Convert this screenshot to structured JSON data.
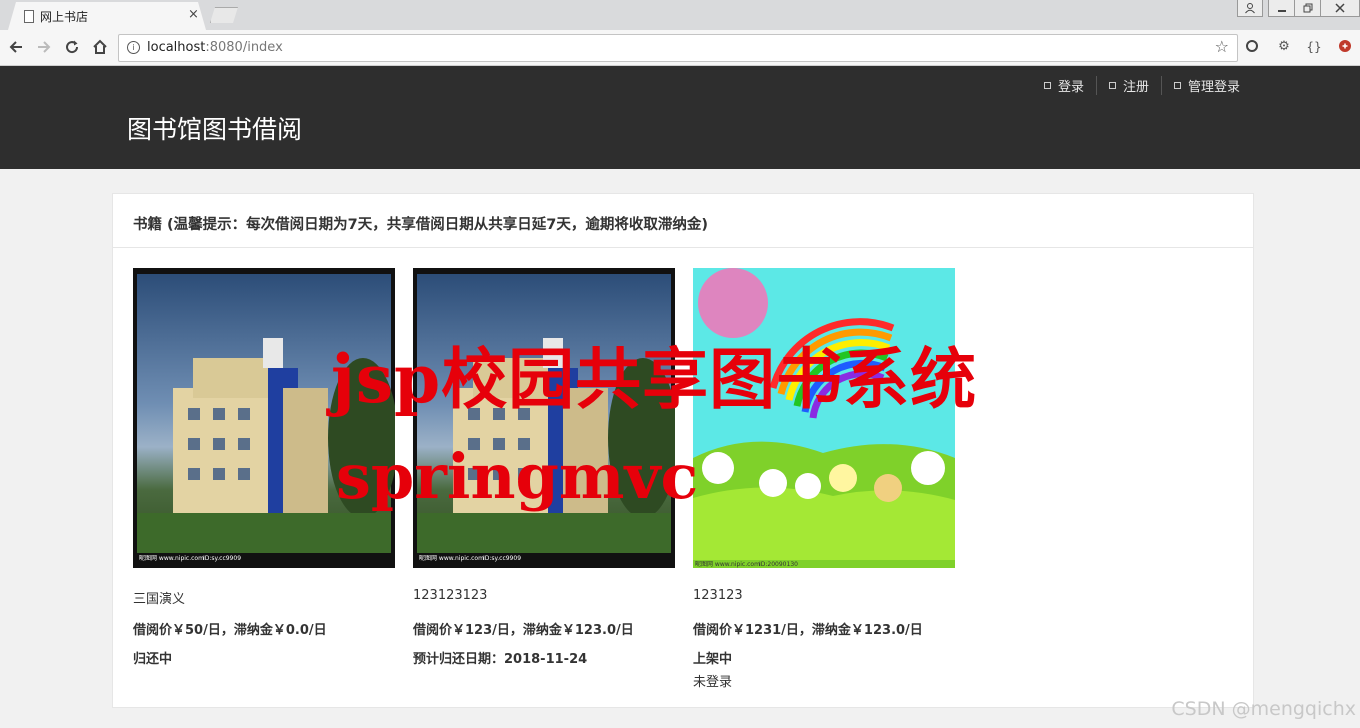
{
  "browser": {
    "tab_title": "网上书店",
    "tab_close": "×",
    "url_host": "localhost",
    "url_rest": ":8080/index"
  },
  "header": {
    "site_title": "图书馆图书借阅",
    "nav": [
      {
        "label": "登录"
      },
      {
        "label": "注册"
      },
      {
        "label": "管理登录"
      }
    ]
  },
  "panel": {
    "title": "书籍 (温馨提示：每次借阅日期为7天，共享借阅日期从共享日延7天，逾期将收取滞纳金)"
  },
  "books": [
    {
      "name": "三国演义",
      "price": "借阅价￥50/日，滞纳金￥0.0/日",
      "status": "归还中",
      "extra": "",
      "cover_caption": "昵图网 www.nipic.com",
      "cover_id": "ID:sy.cc9909"
    },
    {
      "name": "123123123",
      "price": "借阅价￥123/日，滞纳金￥123.0/日",
      "status": "预计归还日期：2018-11-24",
      "extra": "",
      "cover_caption": "昵图网 www.nipic.com",
      "cover_id": "ID:sy.cc9909"
    },
    {
      "name": "123123",
      "price": "借阅价￥1231/日，滞纳金￥123.0/日",
      "status": "上架中",
      "extra": "未登录",
      "cover_caption": "昵图网 www.nipic.com",
      "cover_id": "ID:20090130"
    }
  ],
  "overlay": {
    "watermark_line1": "jsp校园共享图书系统",
    "watermark_line2": "springmvc",
    "csdn": "CSDN @mengqichx"
  },
  "colors": {
    "header_bg": "#2e2e2e",
    "watermark": "#e6000a",
    "page_bg": "#f1f1f1"
  }
}
